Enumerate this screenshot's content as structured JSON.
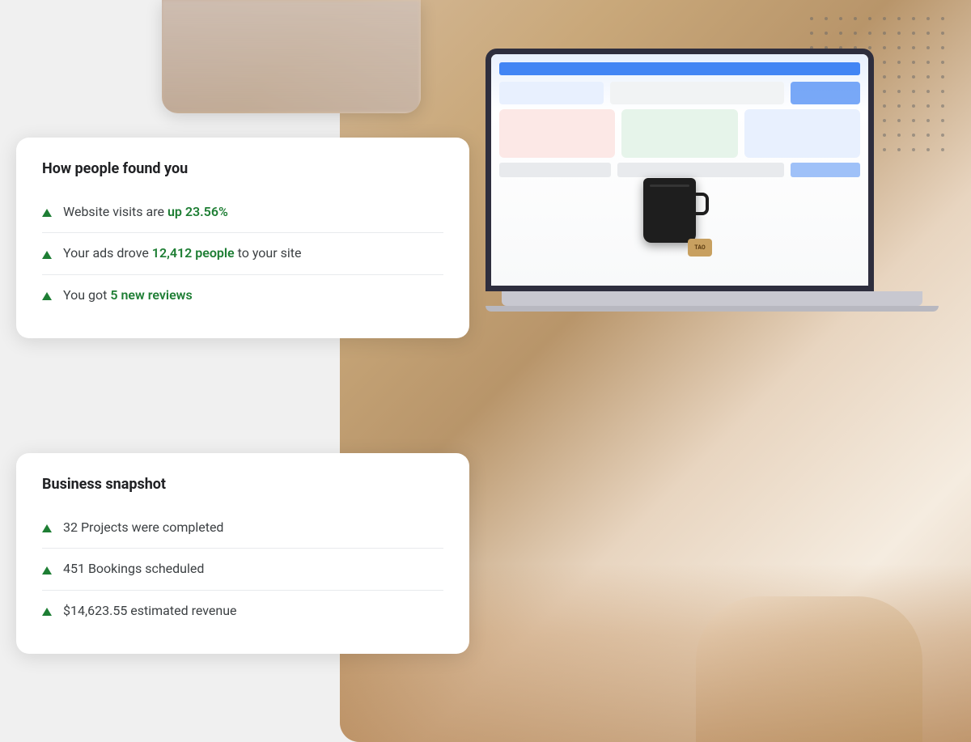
{
  "scene": {
    "background_color": "#f0ece8"
  },
  "card_top": {
    "title": "How people found you",
    "items": [
      {
        "id": "website-visits",
        "text_before": "Website visits are ",
        "highlight": "up 23.56%",
        "text_after": ""
      },
      {
        "id": "ads-drove",
        "text_before": "Your ads drove ",
        "highlight": "12,412 people",
        "text_after": " to your site"
      },
      {
        "id": "new-reviews",
        "text_before": "You got ",
        "highlight": "5 new reviews",
        "text_after": ""
      }
    ]
  },
  "card_bottom": {
    "title": "Business snapshot",
    "items": [
      {
        "id": "projects",
        "text_before": "32 Projects were completed",
        "highlight": "",
        "text_after": ""
      },
      {
        "id": "bookings",
        "text_before": "451 Bookings scheduled",
        "highlight": "",
        "text_after": ""
      },
      {
        "id": "revenue",
        "text_before": "$14,623.55 estimated revenue",
        "highlight": "",
        "text_after": ""
      }
    ]
  },
  "icons": {
    "arrow_up": "▲",
    "accent_color": "#1e7e34"
  }
}
